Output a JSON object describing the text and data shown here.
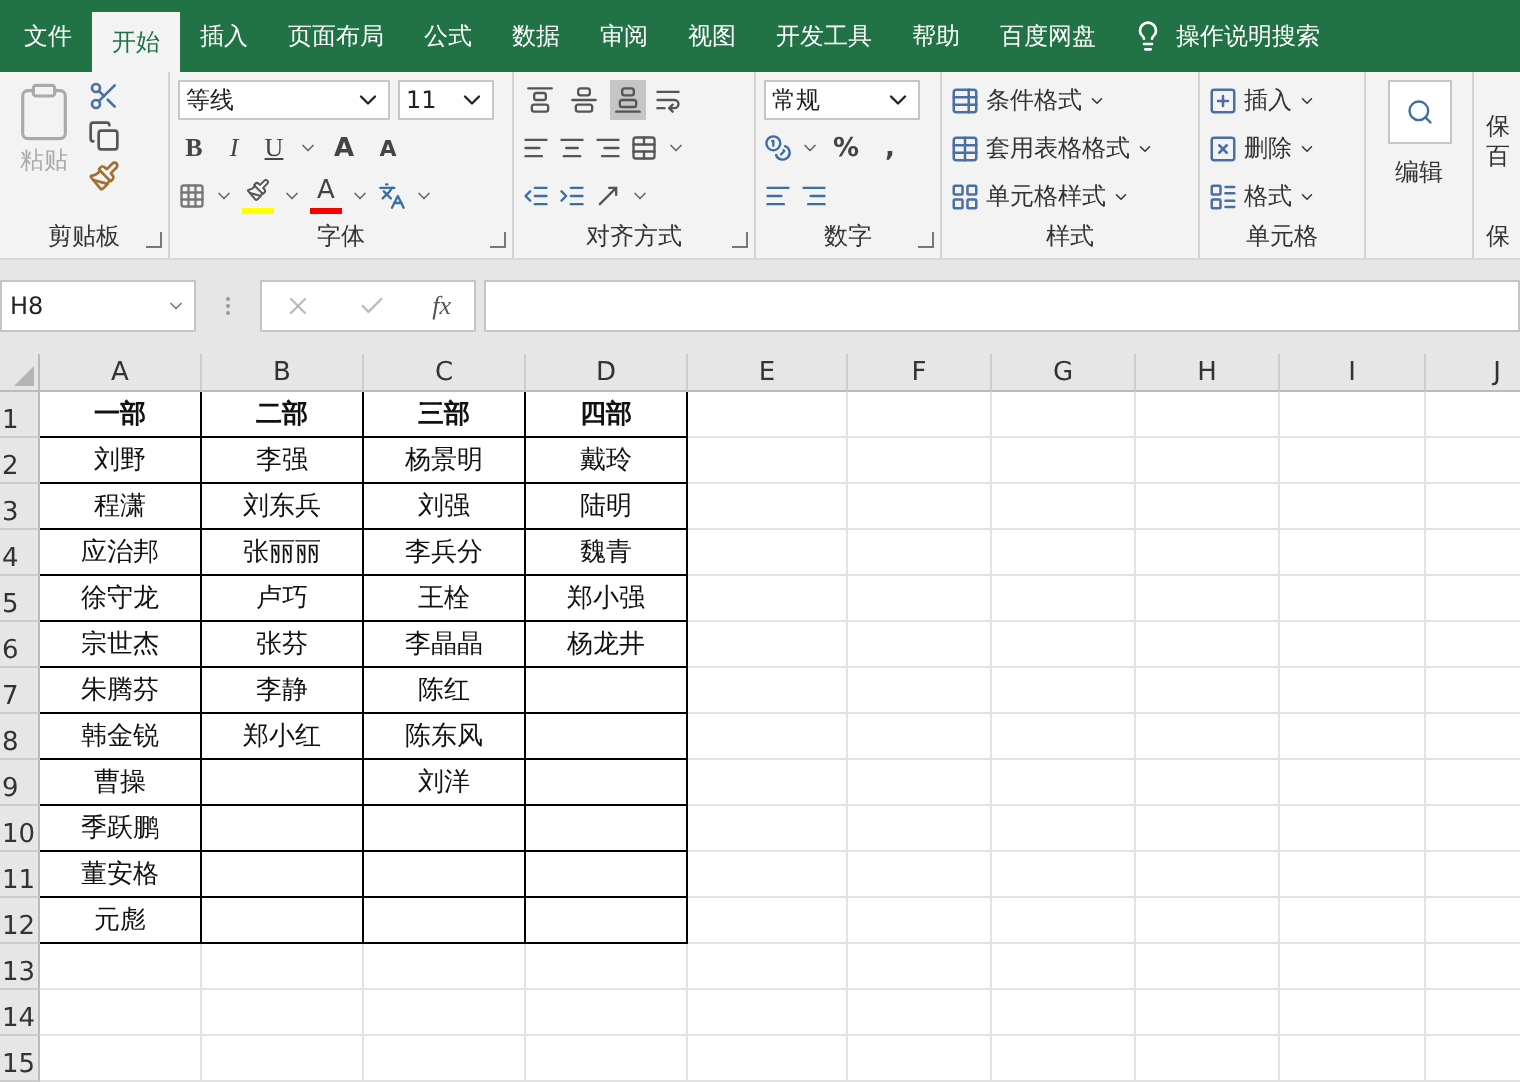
{
  "menu_tabs": [
    {
      "label": "文件",
      "selected": false
    },
    {
      "label": "开始",
      "selected": true
    },
    {
      "label": "插入",
      "selected": false
    },
    {
      "label": "页面布局",
      "selected": false
    },
    {
      "label": "公式",
      "selected": false
    },
    {
      "label": "数据",
      "selected": false
    },
    {
      "label": "审阅",
      "selected": false
    },
    {
      "label": "视图",
      "selected": false
    },
    {
      "label": "开发工具",
      "selected": false
    },
    {
      "label": "帮助",
      "selected": false
    },
    {
      "label": "百度网盘",
      "selected": false
    }
  ],
  "tell_me": "操作说明搜索",
  "ribbon": {
    "clipboard": {
      "label": "剪贴板",
      "paste": "粘贴",
      "paste_disabled": true
    },
    "font": {
      "label": "字体",
      "font_name": "等线",
      "font_size": "11",
      "styles": [
        "B",
        "I",
        "U"
      ],
      "grow": "A",
      "shrink": "A",
      "color_letter": "A"
    },
    "alignment": {
      "label": "对齐方式",
      "vertical_align": [
        {
          "selected": false
        },
        {
          "selected": false
        },
        {
          "selected": true
        }
      ]
    },
    "number": {
      "label": "数字",
      "format": "常规",
      "percent": "%",
      "comma": ","
    },
    "styles": {
      "label": "样式",
      "items": [
        "条件格式",
        "套用表格格式",
        "单元格样式"
      ]
    },
    "cells": {
      "label": "单元格",
      "items": [
        "插入",
        "删除",
        "格式"
      ]
    },
    "editing": {
      "label": "编辑"
    },
    "cut_group": {
      "lines": [
        "保",
        "百"
      ],
      "label": "保"
    }
  },
  "formula_bar": {
    "name_box": "H8",
    "fx": "fx"
  },
  "sheet": {
    "columns": [
      "A",
      "B",
      "C",
      "D",
      "E",
      "F",
      "G",
      "H",
      "I",
      "J"
    ],
    "row_numbers": [
      "1",
      "2",
      "3",
      "4",
      "5",
      "6",
      "7",
      "8",
      "9",
      "10",
      "11",
      "12",
      "13",
      "14",
      "15"
    ],
    "table": [
      {
        "A": "一部",
        "B": "二部",
        "C": "三部",
        "D": "四部"
      },
      {
        "A": "刘野",
        "B": "李强",
        "C": "杨景明",
        "D": "戴玲"
      },
      {
        "A": "程潇",
        "B": "刘东兵",
        "C": "刘强",
        "D": "陆明"
      },
      {
        "A": "应治邦",
        "B": "张丽丽",
        "C": "李兵分",
        "D": "魏青"
      },
      {
        "A": "徐守龙",
        "B": "卢巧",
        "C": "王栓",
        "D": "郑小强"
      },
      {
        "A": "宗世杰",
        "B": "张芬",
        "C": "李晶晶",
        "D": "杨龙井"
      },
      {
        "A": "朱腾芬",
        "B": "李静",
        "C": "陈红"
      },
      {
        "A": "韩金锐",
        "B": "郑小红",
        "C": "陈东风"
      },
      {
        "A": "曹操",
        "C": "刘洋"
      },
      {
        "A": "季跃鹏"
      },
      {
        "A": "董安格"
      },
      {
        "A": "元彪"
      }
    ]
  }
}
